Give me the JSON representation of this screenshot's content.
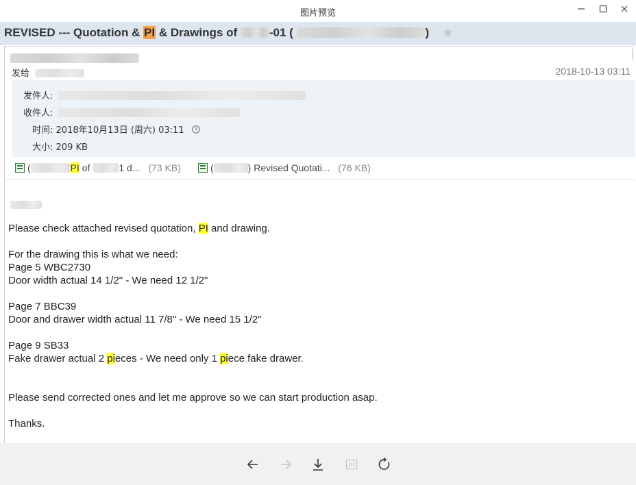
{
  "window": {
    "title": "图片预览"
  },
  "email": {
    "subject_prefix": "REVISED --- Quotation & ",
    "subject_hl": "PI",
    "subject_mid": " & Drawings of ",
    "subject_suffix": "-01 ( ",
    "subject_end": ")",
    "send_to_label": "发给",
    "date": "2018-10-13 03:11",
    "from_label": "发件人:",
    "to_label": "收件人:",
    "time_label": "时间:",
    "time_value": "2018年10月13日 (周六) 03:11",
    "size_label": "大小:",
    "size_value": "209 KB"
  },
  "attachments": [
    {
      "pre": "(",
      "hl": "PI",
      "name": " of ",
      "tail": "1 d...",
      "size": "(73 KB)"
    },
    {
      "pre": "(",
      "tail": ") Revised Quotati...",
      "size": "(76 KB)"
    }
  ],
  "body": {
    "l1a": "Please check attached revised quotation, ",
    "l1hl": "PI",
    "l1b": " and drawing.",
    "l2": "For the drawing this is what we need:",
    "l3": "Page 5 WBC2730",
    "l4": "Door width actual 14 1/2\" - We need 12 1/2\"",
    "l5": "Page 7 BBC39",
    "l6": "Door and drawer width actual 11 7/8\" - We need 15 1/2\"",
    "l7": "Page 9 SB33",
    "l8a": "Fake drawer actual 2 ",
    "l8hl1": "pi",
    "l8b": "eces - We need only 1 ",
    "l8hl2": "pi",
    "l8c": "ece fake drawer.",
    "l9": "Please send corrected ones and let me approve so we can start production asap.",
    "l10": "Thanks."
  },
  "icons": [
    "minimize-icon",
    "maximize-icon",
    "close-icon",
    "star-icon",
    "history-icon",
    "excel-file-icon",
    "arrow-left-icon",
    "arrow-right-icon",
    "download-icon",
    "actual-size-icon",
    "rotate-icon"
  ],
  "colors": {
    "subject_bar": "#dde6ef",
    "detail_bg": "#eef3f7",
    "highlight_orange": "#f7a04a",
    "highlight_yellow": "#ffff33",
    "toolbar_bg": "#f1f1f1"
  }
}
